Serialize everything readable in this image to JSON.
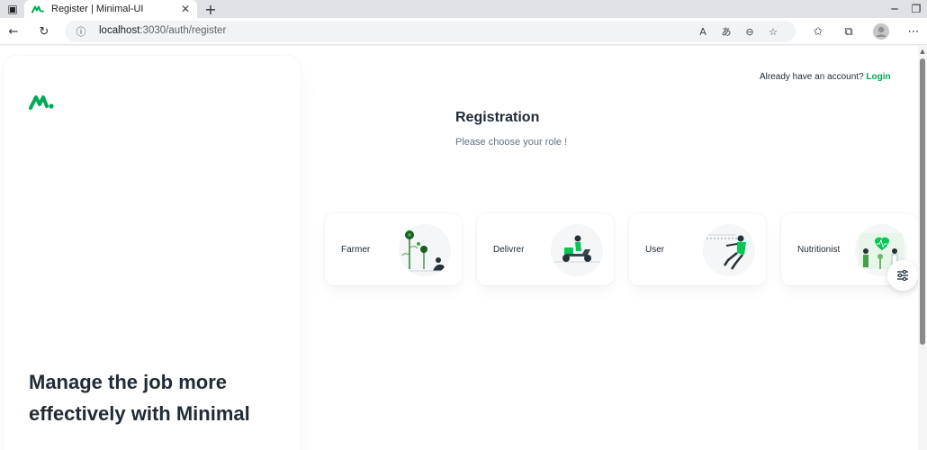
{
  "browser": {
    "tab": {
      "title": "Register | Minimal-UI",
      "favicon": "minimal-logo-icon"
    },
    "new_tab": "+",
    "address": {
      "host": "localhost",
      "path": ":3030/auth/register"
    }
  },
  "page": {
    "hero": {
      "title": "Manage the job more effectively with Minimal"
    },
    "header": {
      "prompt": "Already have an account?",
      "login_label": "Login"
    },
    "registration": {
      "title": "Registration",
      "subtitle": "Please choose your role !"
    },
    "roles": [
      {
        "label": "Farmer"
      },
      {
        "label": "Delivrer"
      },
      {
        "label": "User"
      },
      {
        "label": "Nutritionist"
      }
    ]
  },
  "colors": {
    "primary": "#00ab55",
    "text_primary": "#212b36",
    "text_secondary": "#637381"
  }
}
